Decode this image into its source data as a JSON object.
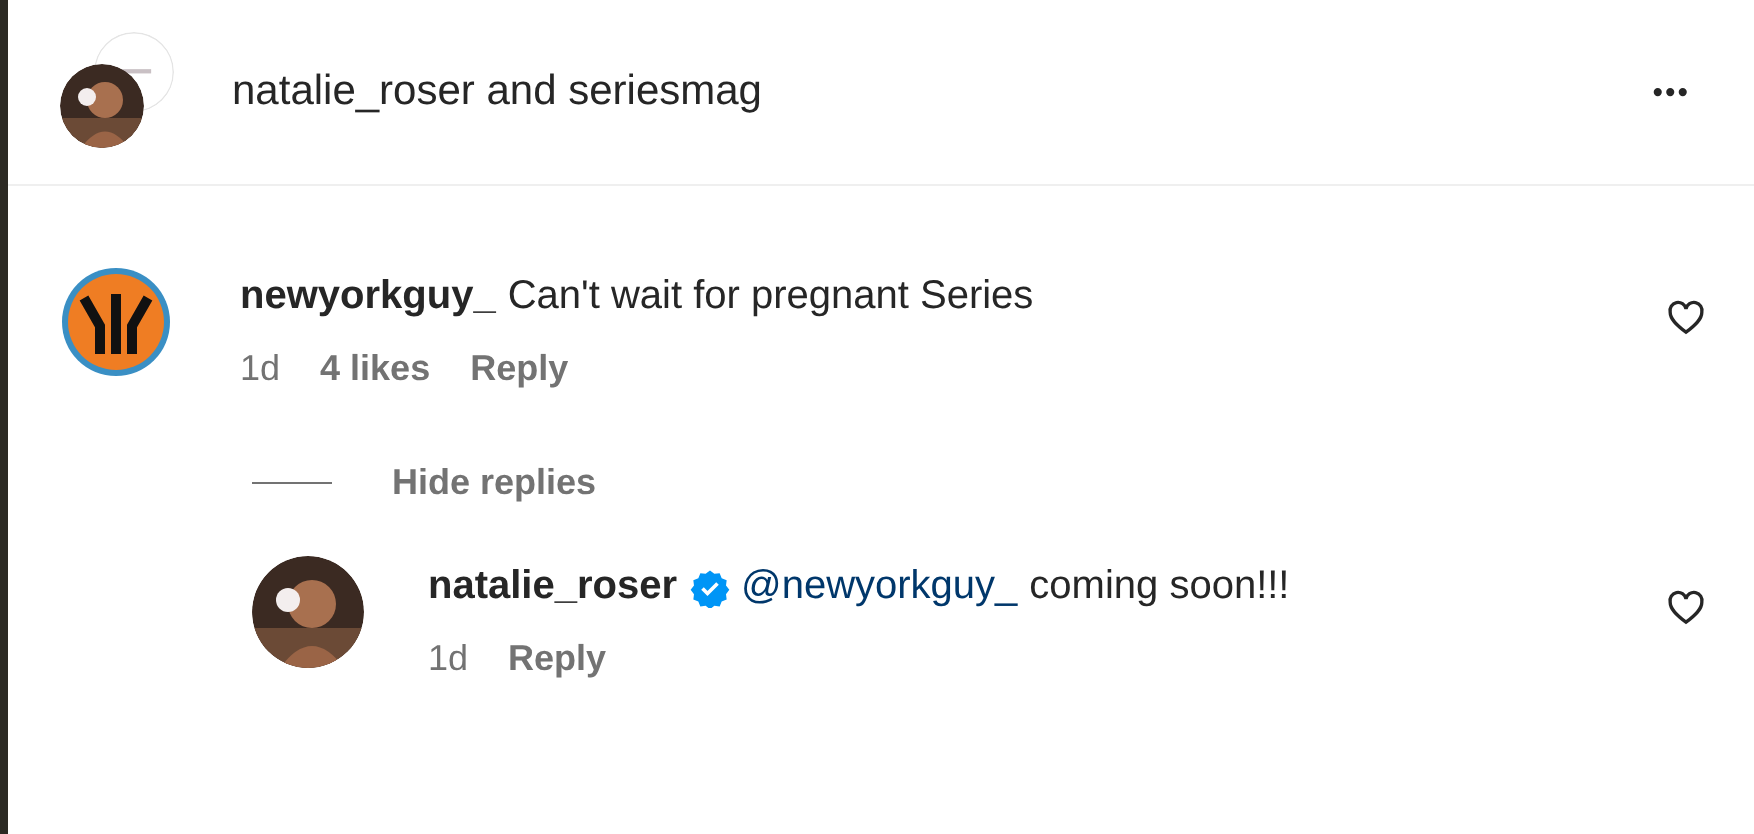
{
  "header": {
    "title": "natalie_roser and seriesmag",
    "more": "•••"
  },
  "comments": [
    {
      "username": "newyorkguy_",
      "kind": "team",
      "text": "Can't wait for pregnant Series",
      "liked": false,
      "time": "1d",
      "likes": "4 likes",
      "reply": "Reply",
      "replies_toggle": {
        "label": "Hide replies",
        "expanded": true
      },
      "replies": [
        {
          "username": "natalie_roser",
          "verified": true,
          "kind": "person",
          "mention": "@newyorkguy_",
          "text": "coming soon!!!",
          "liked": false,
          "time": "1d",
          "reply": "Reply"
        }
      ]
    }
  ]
}
